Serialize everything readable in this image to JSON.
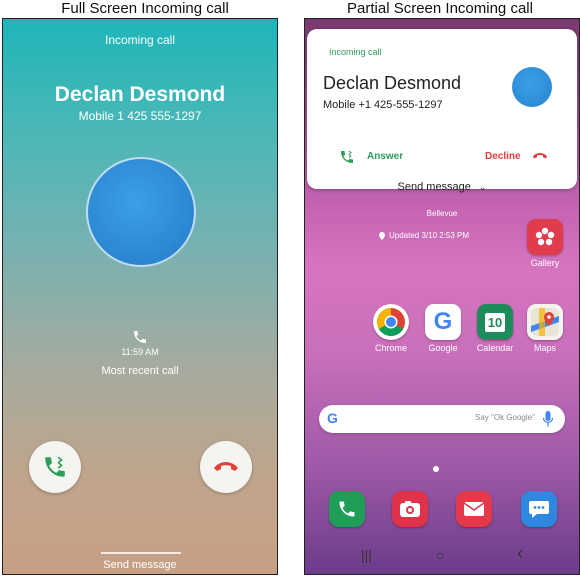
{
  "captions": {
    "left": "Full Screen Incoming call",
    "right": "Partial Screen Incoming call"
  },
  "full_screen": {
    "incoming_label": "Incoming call",
    "caller_name": "Declan Desmond",
    "caller_number": "Mobile 1 425 555-1297",
    "recent_time": "11:59 AM",
    "recent_label": "Most recent call",
    "send_message": "Send message"
  },
  "partial_screen": {
    "notification": {
      "label": "Incoming call",
      "caller_name": "Declan Desmond",
      "caller_number": "Mobile +1 425-555-1297",
      "answer": "Answer",
      "decline": "Decline",
      "send_message": "Send message"
    },
    "home": {
      "city": "Bellevue",
      "updated": "Updated 3/10 2:53 PM",
      "apps": [
        {
          "label": "Gallery"
        },
        {
          "label": "Chrome"
        },
        {
          "label": "Google"
        },
        {
          "label": "Calendar",
          "icon_text": "10"
        },
        {
          "label": "Maps"
        }
      ],
      "search_placeholder": "Say \"Ok Google\"",
      "nav": {
        "recent": "|||",
        "home": "○",
        "back": "‹"
      }
    }
  },
  "colors": {
    "answer_green": "#2e9f5b",
    "decline_red": "#e0403a",
    "avatar_blue": "#2b86d2"
  }
}
